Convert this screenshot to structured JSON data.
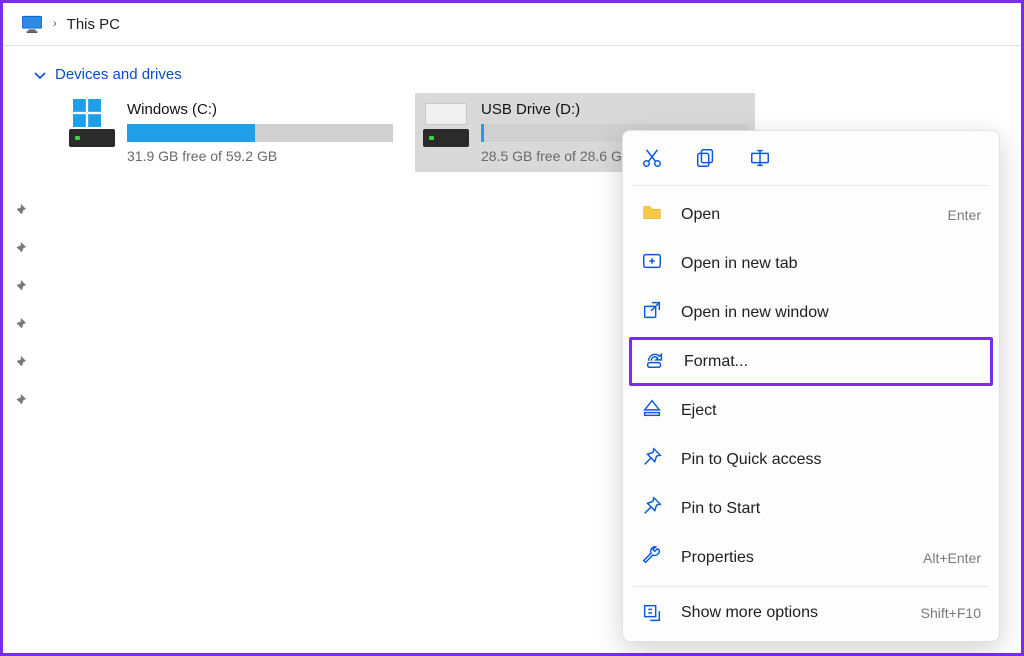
{
  "location": {
    "title": "This PC"
  },
  "section": {
    "title": "Devices and drives"
  },
  "drives": [
    {
      "name": "Windows (C:)",
      "free_text": "31.9 GB free of 59.2 GB",
      "fill_pct": 48,
      "selected": false,
      "type": "os"
    },
    {
      "name": "USB Drive (D:)",
      "free_text": "28.5 GB free of 28.6 GB",
      "fill_pct": 1,
      "selected": true,
      "type": "usb"
    }
  ],
  "context_menu": {
    "top_actions": [
      "cut",
      "copy",
      "rename"
    ],
    "items": [
      {
        "icon": "folder",
        "label": "Open",
        "shortcut": "Enter",
        "highlighted": false
      },
      {
        "icon": "newtab",
        "label": "Open in new tab",
        "shortcut": "",
        "highlighted": false
      },
      {
        "icon": "external",
        "label": "Open in new window",
        "shortcut": "",
        "highlighted": false
      },
      {
        "icon": "format",
        "label": "Format...",
        "shortcut": "",
        "highlighted": true
      },
      {
        "icon": "eject",
        "label": "Eject",
        "shortcut": "",
        "highlighted": false
      },
      {
        "icon": "pin",
        "label": "Pin to Quick access",
        "shortcut": "",
        "highlighted": false
      },
      {
        "icon": "pin2",
        "label": "Pin to Start",
        "shortcut": "",
        "highlighted": false
      },
      {
        "icon": "wrench",
        "label": "Properties",
        "shortcut": "Alt+Enter",
        "highlighted": false
      }
    ],
    "more": {
      "label": "Show more options",
      "shortcut": "Shift+F10"
    }
  }
}
